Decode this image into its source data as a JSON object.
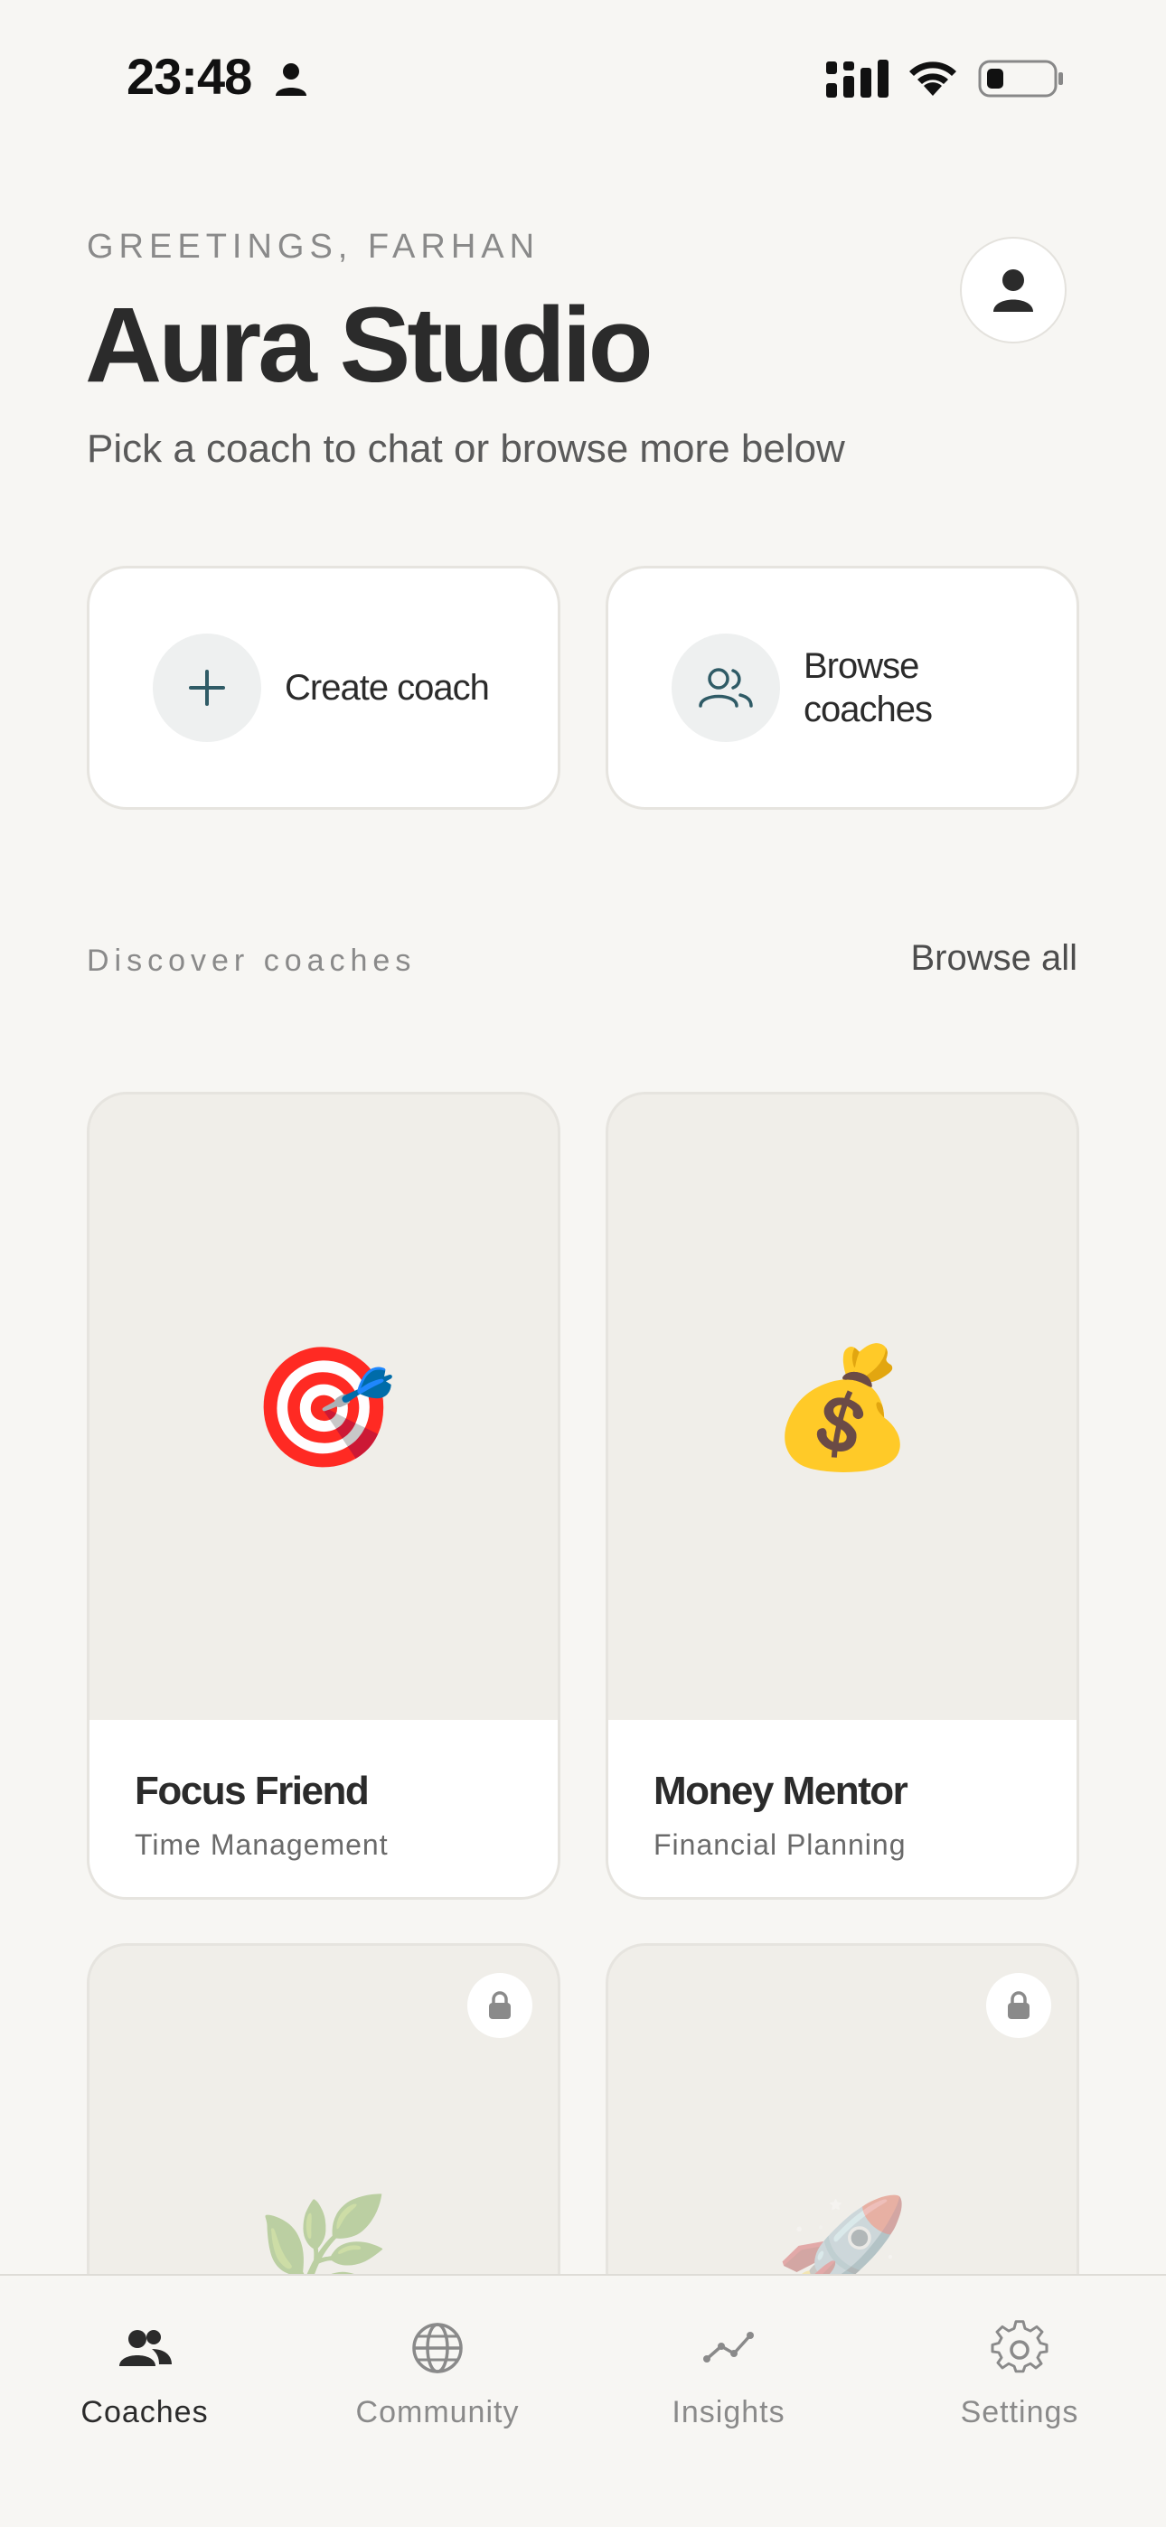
{
  "status_bar": {
    "time": "23:48",
    "icons": [
      "person-icon",
      "signal-icon",
      "wifi-icon",
      "battery-icon"
    ]
  },
  "header": {
    "greeting": "GREETINGS, FARHAN",
    "title": "Aura Studio",
    "subtitle": "Pick a coach to chat or browse more below",
    "profile_icon": "person-icon"
  },
  "actions": [
    {
      "label": "Create coach",
      "icon": "plus-icon"
    },
    {
      "label": "Browse\ncoaches",
      "icon": "people-icon"
    }
  ],
  "discover": {
    "section_label": "Discover coaches",
    "browse_all_label": "Browse all"
  },
  "coaches": [
    {
      "name": "Focus Friend",
      "category": "Time Management",
      "emoji": "🎯",
      "locked": false
    },
    {
      "name": "Money Mentor",
      "category": "Financial Planning",
      "emoji": "💰",
      "locked": false
    },
    {
      "name": "",
      "category": "",
      "emoji": "🌿",
      "locked": true
    },
    {
      "name": "",
      "category": "",
      "emoji": "🚀",
      "locked": true
    }
  ],
  "tab_bar": {
    "tabs": [
      {
        "label": "Coaches",
        "icon": "people-icon",
        "active": true
      },
      {
        "label": "Community",
        "icon": "globe-icon",
        "active": false
      },
      {
        "label": "Insights",
        "icon": "chart-line-icon",
        "active": false
      },
      {
        "label": "Settings",
        "icon": "gear-icon",
        "active": false
      }
    ]
  },
  "colors": {
    "background": "#f7f6f3",
    "card": "#ffffff",
    "accent_icon": "#2f5b66",
    "text_primary": "#2b2b2b",
    "text_muted": "#8a8a8a"
  }
}
